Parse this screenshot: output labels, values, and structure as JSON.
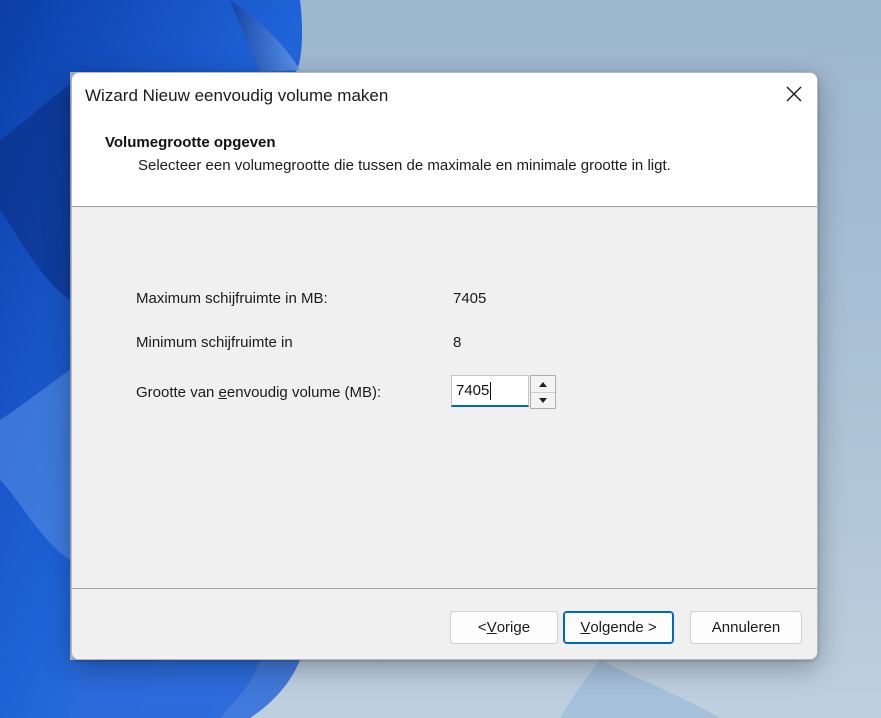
{
  "window": {
    "title": "Wizard Nieuw eenvoudig volume maken"
  },
  "header": {
    "title": "Volumegrootte opgeven",
    "subtitle": "Selecteer een volumegrootte die tussen de maximale en minimale grootte in ligt."
  },
  "fields": {
    "max_label": "Maximum schijfruimte in MB:",
    "max_value": "7405",
    "min_label": "Minimum schijfruimte in",
    "min_value": "8",
    "size_label_pre": "Grootte van ",
    "size_label_accel": "e",
    "size_label_post": "envoudig volume (MB):",
    "size_value": "7405"
  },
  "buttons": {
    "back_pre": "< ",
    "back_accel": "V",
    "back_post": "orige",
    "next_accel": "V",
    "next_post": "olgende >",
    "cancel": "Annuleren"
  },
  "colors": {
    "accent": "#0067c0",
    "dialog_body": "#f0f0f0",
    "wallpaper": "#a9bfd3",
    "wallpaper_bloom": "#1f5fd6"
  },
  "icons": {
    "close": "close-icon",
    "spin_up": "chevron-up-icon",
    "spin_down": "chevron-down-icon"
  }
}
